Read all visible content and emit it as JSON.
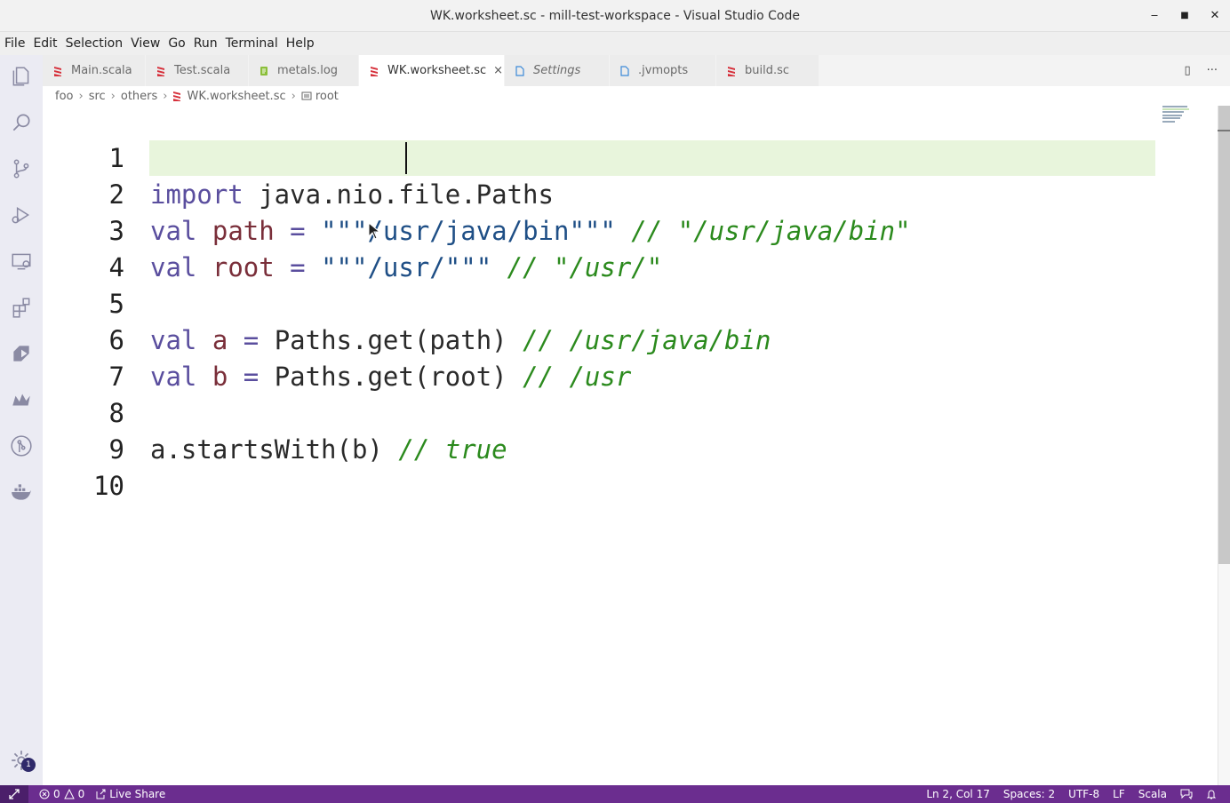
{
  "window": {
    "title": "WK.worksheet.sc - mill-test-workspace - Visual Studio Code",
    "minimize": "‒",
    "maximize": "■",
    "close": "✕"
  },
  "menu": [
    "File",
    "Edit",
    "Selection",
    "View",
    "Go",
    "Run",
    "Terminal",
    "Help"
  ],
  "tabs": [
    {
      "label": "Main.scala",
      "icon": "scala-icon",
      "color": "#d6303b"
    },
    {
      "label": "Test.scala",
      "icon": "scala-icon",
      "color": "#d6303b"
    },
    {
      "label": "metals.log",
      "icon": "log-icon",
      "color": "#8bbf3a"
    },
    {
      "label": "WK.worksheet.sc",
      "icon": "scala-icon",
      "color": "#d6303b",
      "active": true,
      "close": "×"
    },
    {
      "label": "Settings",
      "icon": "file-icon",
      "color": "#3c8ad8",
      "italic": true
    },
    {
      "label": ".jvmopts",
      "icon": "file-icon",
      "color": "#3c8ad8"
    },
    {
      "label": "build.sc",
      "icon": "scala-icon",
      "color": "#d6303b"
    }
  ],
  "tab_actions": {
    "split": "▯",
    "more": "···"
  },
  "breadcrumb": [
    "foo",
    "src",
    "others",
    "WK.worksheet.sc",
    "root"
  ],
  "breadcrumb_sep": "›",
  "editor": {
    "line_numbers": [
      "1",
      "2",
      "3",
      "4",
      "5",
      "6",
      "7",
      "8",
      "9",
      "10"
    ],
    "lines": {
      "l1": {
        "kw": "import",
        "rest": " java.nio.file.Paths"
      },
      "l2": {
        "kw": "val",
        "var": "path",
        "eq": " = ",
        "str": "\"\"\"/usr/java/bin\"\"\"",
        "cm": "// \"/usr/java/bin\""
      },
      "l3": {
        "kw": "val",
        "var": "root",
        "eq": " = ",
        "str": "\"\"\"/usr/\"\"\"",
        "cm": "// \"/usr/\""
      },
      "l5": {
        "kw": "val",
        "var": "a",
        "eq": " = ",
        "rest": "Paths.get(path) ",
        "cm": "// /usr/java/bin"
      },
      "l6": {
        "kw": "val",
        "var": "b",
        "eq": " = ",
        "rest": "Paths.get(root) ",
        "cm": "// /usr"
      },
      "l8": {
        "rest": "a.startsWith(b) ",
        "cm": "// true"
      }
    }
  },
  "status": {
    "errors": "0",
    "warnings": "0",
    "live_share": "Live Share",
    "position": "Ln 2, Col 17",
    "spaces": "Spaces: 2",
    "encoding": "UTF-8",
    "eol": "LF",
    "language": "Scala"
  },
  "settings_badge": "1",
  "colors": {
    "status_bar": "#6b2d8f",
    "keyword": "#5a4e9e",
    "comment": "#2b8a1d",
    "string": "#1f4f86",
    "line_highlight": "#e8f5dc"
  }
}
